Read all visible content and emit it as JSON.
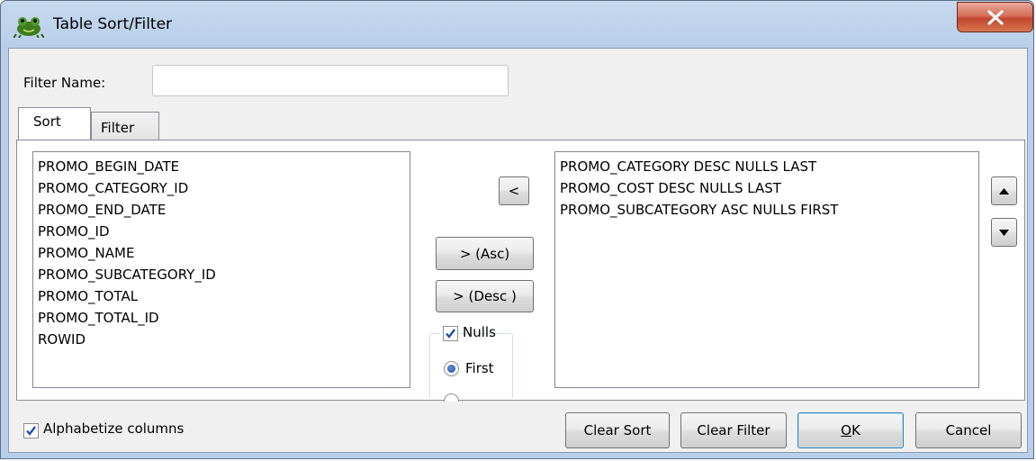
{
  "window": {
    "title": "Table Sort/Filter"
  },
  "filter_name": {
    "label": "Filter Name:",
    "value": "",
    "placeholder": ""
  },
  "tabs": [
    {
      "label": "Sort",
      "active": true
    },
    {
      "label": "Filter",
      "active": false
    }
  ],
  "available_columns": [
    "PROMO_BEGIN_DATE",
    "PROMO_CATEGORY_ID",
    "PROMO_END_DATE",
    "PROMO_ID",
    "PROMO_NAME",
    "PROMO_SUBCATEGORY_ID",
    "PROMO_TOTAL",
    "PROMO_TOTAL_ID",
    "ROWID"
  ],
  "sort_columns": [
    "PROMO_CATEGORY DESC NULLS LAST",
    "PROMO_COST DESC NULLS LAST",
    "PROMO_SUBCATEGORY ASC NULLS FIRST"
  ],
  "buttons": {
    "remove": "<",
    "add_asc": "> (Asc)",
    "add_desc": "> (Desc )",
    "clear_sort": "Clear Sort",
    "clear_filter": "Clear Filter",
    "ok_prefix": "O",
    "ok_rest": "K",
    "cancel": "Cancel"
  },
  "nulls": {
    "label": "Nulls",
    "checked": true,
    "first_label": "First",
    "first_selected": true
  },
  "alphabetize": {
    "label": "Alphabetize columns",
    "checked": true
  },
  "icons": {
    "move_up": "triangle-up-icon",
    "move_down": "triangle-down-icon",
    "close": "close-x-icon",
    "app": "frog-icon"
  },
  "colors": {
    "close_button": "#c9513a",
    "title_bar": "#b9cfe9",
    "dialog_bg": "#f0f0f0",
    "check_mark": "#2150a8"
  }
}
